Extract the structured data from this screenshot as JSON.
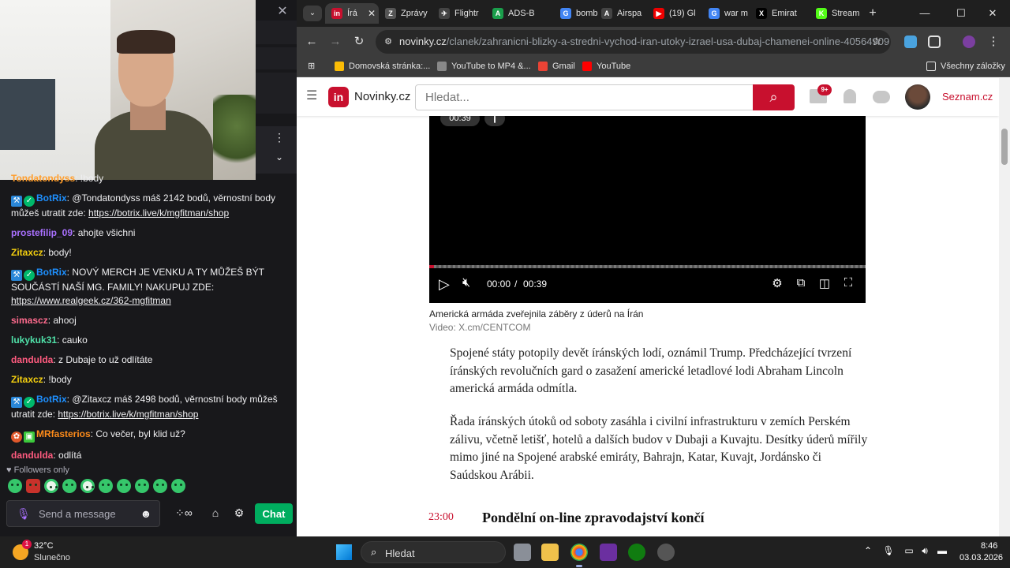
{
  "chat": {
    "messages": [
      {
        "user": "Tondatondyss",
        "color": "#ff9d2b",
        "text": " !body",
        "link": ""
      },
      {
        "user": "BotRix",
        "color": "#1e90ff",
        "text": " @Tondatondyss máš 2142 bodů, věrnostní body můžeš utratit zde: ",
        "link": "https://botrix.live/k/mgfitman/shop",
        "badges": true
      },
      {
        "user": "prostefilip_09",
        "color": "#a970ff",
        "text": " ahojte všichni",
        "link": ""
      },
      {
        "user": "Zitaxcz",
        "color": "#f5d00f",
        "text": " body!",
        "link": ""
      },
      {
        "user": "BotRix",
        "color": "#1e90ff",
        "text": " NOVÝ MERCH JE VENKU A TY MŮŽEŠ BÝT SOUČÁSTÍ NAŠÍ MG. FAMILY! NAKUPUJ ZDE: ",
        "link": "https://www.realgeek.cz/362-mgfitman",
        "badges": true
      },
      {
        "user": "simascz",
        "color": "#ff6b8e",
        "text": " ahooj",
        "link": ""
      },
      {
        "user": "lukykuk31",
        "color": "#4fe0a8",
        "text": " cauko",
        "link": ""
      },
      {
        "user": "dandulda",
        "color": "#ff5b7f",
        "text": " z Dubaje to už odlítáte",
        "link": ""
      },
      {
        "user": "Zitaxcz",
        "color": "#f5d00f",
        "text": " !body",
        "link": ""
      },
      {
        "user": "BotRix",
        "color": "#1e90ff",
        "text": " @Zitaxcz máš 2498 bodů, věrnostní body můžeš utratit zde: ",
        "link": "https://botrix.live/k/mgfitman/shop",
        "badges": true
      },
      {
        "user": "MRfasterios",
        "color": "#ff8c1a",
        "text": " Co večer, byl klid už?",
        "link": ""
      },
      {
        "user": "dandulda",
        "color": "#ff5b7f",
        "text": " odlítá",
        "link": ""
      }
    ],
    "followers_only": "Followers only",
    "input_placeholder": "Send a message",
    "chat_button": "Chat"
  },
  "browser": {
    "tabs": [
      {
        "label": "Írá",
        "icon": "in",
        "color": "#c8102e"
      },
      {
        "label": "Zprávy",
        "icon": "Z",
        "color": "#555"
      },
      {
        "label": "Flightr",
        "icon": "✈",
        "color": "#444"
      },
      {
        "label": "ADS-B",
        "icon": "A",
        "color": "#1a9e4b"
      },
      {
        "label": "bomb",
        "icon": "G",
        "color": "#4285f4"
      },
      {
        "label": "Airspa",
        "icon": "A",
        "color": "#444"
      },
      {
        "label": "(19) Gl",
        "icon": "▶",
        "color": "#e00"
      },
      {
        "label": "war m",
        "icon": "G",
        "color": "#4285f4"
      },
      {
        "label": "Emirat",
        "icon": "X",
        "color": "#000"
      },
      {
        "label": "Stream",
        "icon": "K",
        "color": "#53fc18"
      }
    ],
    "url_domain": "novinky.cz",
    "url_path": "/clanek/zahranicni-blizky-a-stredni-vychod-iran-utoky-izrael-usa-dubaj-chamenei-online-40564909",
    "bookmarks": [
      {
        "label": "Domovská stránka:...",
        "color": "#fbbc05"
      },
      {
        "label": "YouTube to MP4 &...",
        "color": "#888"
      },
      {
        "label": "Gmail",
        "color": "#ea4335"
      },
      {
        "label": "YouTube",
        "color": "#ff0000"
      }
    ],
    "all_bookmarks": "Všechny záložky"
  },
  "site": {
    "logo_badge": "in",
    "logo_text": "Novinky.cz",
    "search_placeholder": "Hledat...",
    "mail_badge": "9+",
    "seznam": "Seznam.cz",
    "video": {
      "chip_time": "00:39",
      "current": "00:00",
      "separator": "/",
      "total": "00:39",
      "progress": 0.01
    },
    "caption": "Americká armáda zveřejnila záběry z úderů na Írán",
    "credit": "Video: X.cm/CENTCOM",
    "para1": "Spojené státy potopily devět íránských lodí, oznámil Trump. Předcházející tvrzení íránských revolučních gard o zasažení americké letadlové lodi Abraham Lincoln americká armáda odmítla.",
    "para2": "Řada íránských útoků od soboty zasáhla i civilní infrastrukturu v zemích Perském zálivu, včetně letišť, hotelů a dalších budov v Dubaji a Kuvajtu. Desítky úderů mířily mimo jiné na Spojené arabské emiráty, Bahrajn, Katar, Kuvajt, Jordánsko či Saúdskou Arábii.",
    "live_time": "23:00",
    "live_heading": "Pondělní on-line zpravodajství končí"
  },
  "taskbar": {
    "weather_badge": "1",
    "temp": "32°C",
    "weather": "Slunečno",
    "search": "Hledat",
    "time": "8:46",
    "date": "03.03.2026"
  }
}
